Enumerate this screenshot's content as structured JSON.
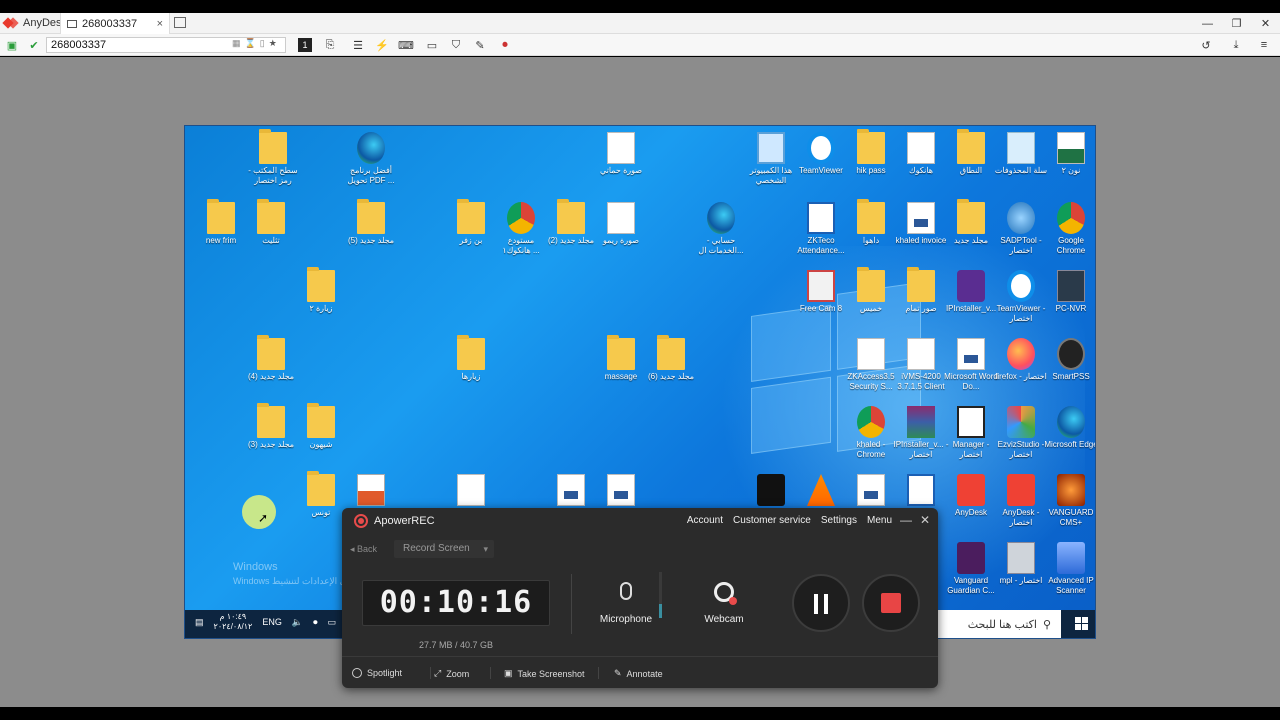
{
  "app": {
    "name": "AnyDesk"
  },
  "tab": {
    "label": "268003337",
    "close": "×"
  },
  "window_controls": [
    "—",
    "❐",
    "✕"
  ],
  "address": {
    "value": "268003337"
  },
  "desktop_icons": [
    {
      "id": "i1",
      "label": "سطح المكتب - رمز اختصار",
      "kind": "folder"
    },
    {
      "id": "i2",
      "label": "أفضل برنامج تحويل PDF ...",
      "kind": "edge"
    },
    {
      "id": "i3",
      "label": "صورة حماتي",
      "kind": "doc"
    },
    {
      "id": "i4",
      "label": "هذا الكمبيوتر الشخصي",
      "kind": "pc"
    },
    {
      "id": "i5",
      "label": "TeamViewer",
      "kind": "tv"
    },
    {
      "id": "i6",
      "label": "hik pass",
      "kind": "folder"
    },
    {
      "id": "i7",
      "label": "هانكوك",
      "kind": "doc"
    },
    {
      "id": "i8",
      "label": "النطاق",
      "kind": "folder"
    },
    {
      "id": "i9",
      "label": "سلة المحذوفات",
      "kind": "bin"
    },
    {
      "id": "i10",
      "label": "نون ٢",
      "kind": "excel"
    },
    {
      "id": "i11",
      "label": "new frim",
      "kind": "folder"
    },
    {
      "id": "i12",
      "label": "تثليث",
      "kind": "folder"
    },
    {
      "id": "i13",
      "label": "(5) مجلد جديد",
      "kind": "folder"
    },
    {
      "id": "i14",
      "label": "بن زفر",
      "kind": "folder"
    },
    {
      "id": "i15",
      "label": "مستودع هانكوك١ ...",
      "kind": "chrome"
    },
    {
      "id": "i16",
      "label": "(2) مجلد جديد",
      "kind": "folder"
    },
    {
      "id": "i17",
      "label": "صورة ريمو",
      "kind": "doc"
    },
    {
      "id": "i18",
      "label": "حسابي - الخدمات ال...",
      "kind": "edge"
    },
    {
      "id": "i19",
      "label": "ZKTeco Attendance...",
      "kind": "zk"
    },
    {
      "id": "i20",
      "label": "داهوا",
      "kind": "folder"
    },
    {
      "id": "i21",
      "label": "khaled invoice",
      "kind": "word"
    },
    {
      "id": "i22",
      "label": "مجلد جديد",
      "kind": "folder"
    },
    {
      "id": "i23",
      "label": "SADPTool - اختصار",
      "kind": "sadp"
    },
    {
      "id": "i24",
      "label": "Google Chrome",
      "kind": "chrome"
    },
    {
      "id": "i25",
      "label": "زيارة ٢",
      "kind": "folder"
    },
    {
      "id": "i26",
      "label": "Free Cam 8",
      "kind": "cam"
    },
    {
      "id": "i27",
      "label": "خميس",
      "kind": "folder"
    },
    {
      "id": "i28",
      "label": "صور تمام",
      "kind": "folder"
    },
    {
      "id": "i29",
      "label": "IPInstaller_v...",
      "kind": "ipi"
    },
    {
      "id": "i30",
      "label": "TeamViewer - اختصار",
      "kind": "tv"
    },
    {
      "id": "i31",
      "label": "PC-NVR",
      "kind": "pcnvr"
    },
    {
      "id": "i32",
      "label": "(4) مجلد جديد",
      "kind": "folder"
    },
    {
      "id": "i33",
      "label": "زيارها",
      "kind": "folder"
    },
    {
      "id": "i34",
      "label": "massage",
      "kind": "folder"
    },
    {
      "id": "i35",
      "label": "(6) مجلد جديد",
      "kind": "folder"
    },
    {
      "id": "i36",
      "label": "ZKAccess3.5 Security S...",
      "kind": "doc"
    },
    {
      "id": "i37",
      "label": "iVMS-4200 3.7.1.5 Client",
      "kind": "doc"
    },
    {
      "id": "i38",
      "label": "Microsoft Word Do...",
      "kind": "word"
    },
    {
      "id": "i39",
      "label": "firefox - اختصار",
      "kind": "firefox"
    },
    {
      "id": "i40",
      "label": "SmartPSS",
      "kind": "smart"
    },
    {
      "id": "i41",
      "label": "(3) مجلد جديد",
      "kind": "folder"
    },
    {
      "id": "i42",
      "label": "شيهون",
      "kind": "folder"
    },
    {
      "id": "i43",
      "label": "khaled - Chrome",
      "kind": "chrome"
    },
    {
      "id": "i44",
      "label": "IPInstaller_v... - اختصار",
      "kind": "rar"
    },
    {
      "id": "i45",
      "label": "Manager - اختصار",
      "kind": "mgr"
    },
    {
      "id": "i46",
      "label": "EzvizStudio - اختصار",
      "kind": "ezviz"
    },
    {
      "id": "i47",
      "label": "Microsoft Edge",
      "kind": "edge"
    },
    {
      "id": "i48",
      "label": "تونس",
      "kind": "folder"
    },
    {
      "id": "i49",
      "label": "",
      "kind": "wise"
    },
    {
      "id": "i50",
      "label": "",
      "kind": "doc"
    },
    {
      "id": "i51",
      "label": "",
      "kind": "word"
    },
    {
      "id": "i52",
      "label": "",
      "kind": "word"
    },
    {
      "id": "i53",
      "label": "",
      "kind": "wnv"
    },
    {
      "id": "i54",
      "label": "",
      "kind": "vlc"
    },
    {
      "id": "i55",
      "label": "",
      "kind": "word"
    },
    {
      "id": "i56",
      "label": "",
      "kind": "zk"
    },
    {
      "id": "i57",
      "label": "AnyDesk",
      "kind": "anydesk"
    },
    {
      "id": "i58",
      "label": "AnyDesk - اختصار",
      "kind": "anydesk"
    },
    {
      "id": "i59",
      "label": "VANGUARD CMS+",
      "kind": "vanguard"
    },
    {
      "id": "i60",
      "label": "Vanguard Guardian C...",
      "kind": "guardian"
    },
    {
      "id": "i61",
      "label": "mpl - اختصار",
      "kind": "lite"
    },
    {
      "id": "i62",
      "label": "Advanced IP Scanner",
      "kind": "ipscan"
    }
  ],
  "watermark": {
    "line1": "Windows",
    "line2": "Windows انتقل إلى الإعدادات لتنشيط"
  },
  "taskbar": {
    "lang": "ENG",
    "time": "١٠:٤٩ م",
    "date": "٢٠٢٤/٠٨/١٢",
    "search_placeholder": "اكتب هنا للبحث"
  },
  "recorder": {
    "title": "ApowerREC",
    "menu": [
      "Account",
      "Customer service",
      "Settings",
      "Menu"
    ],
    "back": "Back",
    "mode": "Record Screen",
    "timer": "00:10:16",
    "size": "27.7 MB / 40.7 GB",
    "microphone": "Microphone",
    "webcam": "Webcam",
    "footer": [
      "Spotlight",
      "Zoom",
      "Take Screenshot",
      "Annotate"
    ]
  },
  "colors": {
    "desktop": "#1a9cf0",
    "recorder_bg": "#2b2b2b",
    "stop_red": "#e84545",
    "anydesk_red": "#e8392d"
  }
}
